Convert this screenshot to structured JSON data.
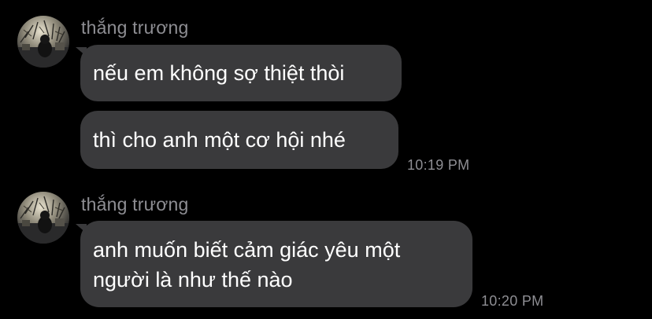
{
  "colors": {
    "background": "#000000",
    "bubble": "#3a3a3c",
    "text": "#ffffff",
    "meta": "#8e8e93"
  },
  "groups": [
    {
      "sender": "thắng trương",
      "avatar_icon": "profile-photo-icon",
      "messages": [
        {
          "lines": [
            "nếu em không sợ thiệt thòi"
          ]
        },
        {
          "lines": [
            "thì cho anh một cơ hội nhé"
          ]
        }
      ],
      "time": "10:19 PM"
    },
    {
      "sender": "thắng trương",
      "avatar_icon": "profile-photo-icon",
      "messages": [
        {
          "lines": [
            "anh muốn biết cảm giác yêu một",
            "người là như thế nào"
          ]
        }
      ],
      "time": "10:20 PM"
    }
  ]
}
